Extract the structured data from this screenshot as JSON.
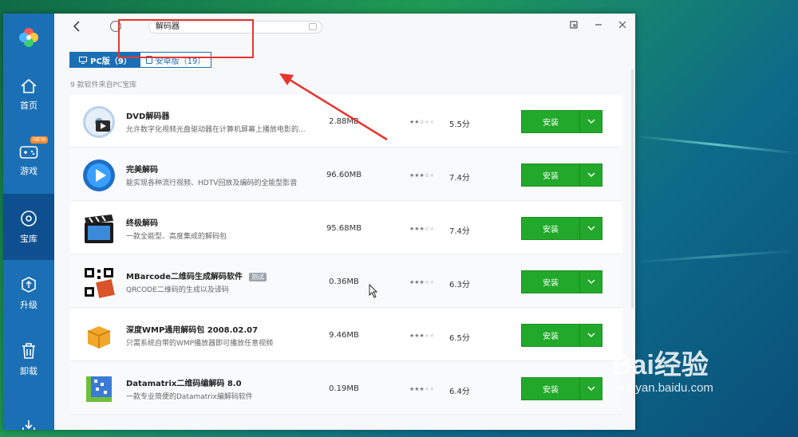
{
  "sidebar": {
    "items": [
      {
        "label": "首页",
        "icon": "home-icon"
      },
      {
        "label": "游戏",
        "icon": "gamepad-icon",
        "badge": "NEW"
      },
      {
        "label": "宝库",
        "icon": "disc-icon",
        "active": true
      },
      {
        "label": "升级",
        "icon": "upgrade-icon"
      },
      {
        "label": "卸载",
        "icon": "trash-icon"
      },
      {
        "label": "",
        "icon": "download-icon"
      }
    ]
  },
  "search": {
    "value": "解码器"
  },
  "tabs": [
    {
      "label": "PC版（9）",
      "icon": "monitor-icon",
      "active": true
    },
    {
      "label": "安卓版（19）",
      "icon": "phone-icon",
      "active": false
    }
  ],
  "source_note": "9 款软件来自PC宝库",
  "install_label": "安装",
  "apps": [
    {
      "name": "DVD解码器",
      "desc": "允许数字化视频光盘驱动器在计算机屏幕上播放电影的...",
      "size": "2.88MB",
      "rating": 2.5,
      "score": "5.5分",
      "icon": "dvd-app-icon"
    },
    {
      "name": "完美解码",
      "desc": "能实现各种流行视频、HDTV回放及编码的全能型影音",
      "size": "96.60MB",
      "rating": 3.5,
      "score": "7.4分",
      "icon": "play-app-icon"
    },
    {
      "name": "终极解码",
      "desc": "一款全能型、高度集成的解码包",
      "size": "95.68MB",
      "rating": 3.5,
      "score": "7.4分",
      "icon": "clapper-app-icon"
    },
    {
      "name": "MBarcode二维码生成解码软件",
      "tag": "测试",
      "desc": "QRCODE二维码的生成以及译码",
      "size": "0.36MB",
      "rating": 3,
      "score": "6.3分",
      "icon": "qrcode-app-icon"
    },
    {
      "name": "深度WMP通用解码包 2008.02.07",
      "desc": "只需系统自带的WMP播放器即可播放任意视频",
      "size": "9.46MB",
      "rating": 3,
      "score": "6.5分",
      "icon": "box-app-icon"
    },
    {
      "name": "Datamatrix二维码编解码 8.0",
      "desc": "一款专业简便的Datamatrix编解码软件",
      "size": "0.19MB",
      "rating": 3,
      "score": "6.4分",
      "icon": "datamatrix-app-icon"
    }
  ],
  "watermark": {
    "brand": "Bai经验",
    "url": "jingyan.baidu.com"
  },
  "colors": {
    "sidebar": "#1b6fb5",
    "sidebar_active": "#0e4f8f",
    "install": "#22a82a",
    "annotation": "#e8352f"
  }
}
